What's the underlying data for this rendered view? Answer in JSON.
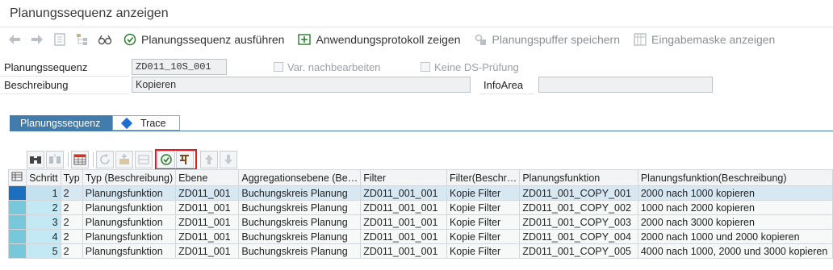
{
  "window": {
    "title": "Planungssequenz anzeigen"
  },
  "toolbar": {
    "icons": [
      "back-arrow-icon",
      "forward-arrow-icon",
      "document-icon",
      "hierarchy-icon",
      "glasses-icon"
    ],
    "buttons": [
      {
        "label": "Planungssequenz ausführen",
        "icon": "execute-icon",
        "enabled": true
      },
      {
        "label": "Anwendungsprotokoll zeigen",
        "icon": "log-icon",
        "enabled": true
      },
      {
        "label": "Planungspuffer speichern",
        "icon": "save-buffer-icon",
        "enabled": false
      },
      {
        "label": "Eingabemaske anzeigen",
        "icon": "input-mask-icon",
        "enabled": false
      }
    ]
  },
  "form": {
    "sequence_label": "Planungssequenz",
    "sequence_value": "ZD011_10S_001",
    "var_checkbox_label": "Var. nachbearbeiten",
    "ds_checkbox_label": "Keine DS-Prüfung",
    "description_label": "Beschreibung",
    "description_value": "Kopieren",
    "infoarea_label": "InfoArea",
    "infoarea_value": ""
  },
  "tabs": [
    {
      "label": "Planungssequenz",
      "active": true
    },
    {
      "label": "Trace",
      "active": false
    }
  ],
  "grid": {
    "columns": [
      "Schritt",
      "Typ",
      "Typ (Beschreibung)",
      "Ebene",
      "Aggregationsebene (Be…",
      "Filter",
      "Filter(Beschr…",
      "Planungsfunktion",
      "Planungsfunktion(Beschreibung)"
    ],
    "rows": [
      {
        "step": "1",
        "type": "2",
        "type_desc": "Planungsfunktion",
        "level": "ZD011_001",
        "agg": "Buchungskreis Planung",
        "filter": "ZD011_001_001",
        "filter_desc": "Kopie Filter",
        "func": "ZD011_001_COPY_001",
        "func_desc": "2000 nach 1000 kopieren"
      },
      {
        "step": "2",
        "type": "2",
        "type_desc": "Planungsfunktion",
        "level": "ZD011_001",
        "agg": "Buchungskreis Planung",
        "filter": "ZD011_001_001",
        "filter_desc": "Kopie Filter",
        "func": "ZD011_001_COPY_002",
        "func_desc": "1000 nach 2000 kopieren"
      },
      {
        "step": "3",
        "type": "2",
        "type_desc": "Planungsfunktion",
        "level": "ZD011_001",
        "agg": "Buchungskreis Planung",
        "filter": "ZD011_001_001",
        "filter_desc": "Kopie Filter",
        "func": "ZD011_001_COPY_003",
        "func_desc": "2000 nach 3000 kopieren"
      },
      {
        "step": "4",
        "type": "2",
        "type_desc": "Planungsfunktion",
        "level": "ZD011_001",
        "agg": "Buchungskreis Planung",
        "filter": "ZD011_001_001",
        "filter_desc": "Kopie Filter",
        "func": "ZD011_001_COPY_004",
        "func_desc": "2000 nach 1000 und 2000 kopieren"
      },
      {
        "step": "5",
        "type": "2",
        "type_desc": "Planungsfunktion",
        "level": "ZD011_001",
        "agg": "Buchungskreis Planung",
        "filter": "ZD011_001_001",
        "filter_desc": "Kopie Filter",
        "func": "ZD011_001_COPY_005",
        "func_desc": "4000 nach 1000, 2000 und 3000 kopieren"
      }
    ]
  },
  "colors": {
    "tab_active": "#427cac",
    "highlight_box": "#e5171f",
    "row_selected": "#d8e8f3"
  }
}
